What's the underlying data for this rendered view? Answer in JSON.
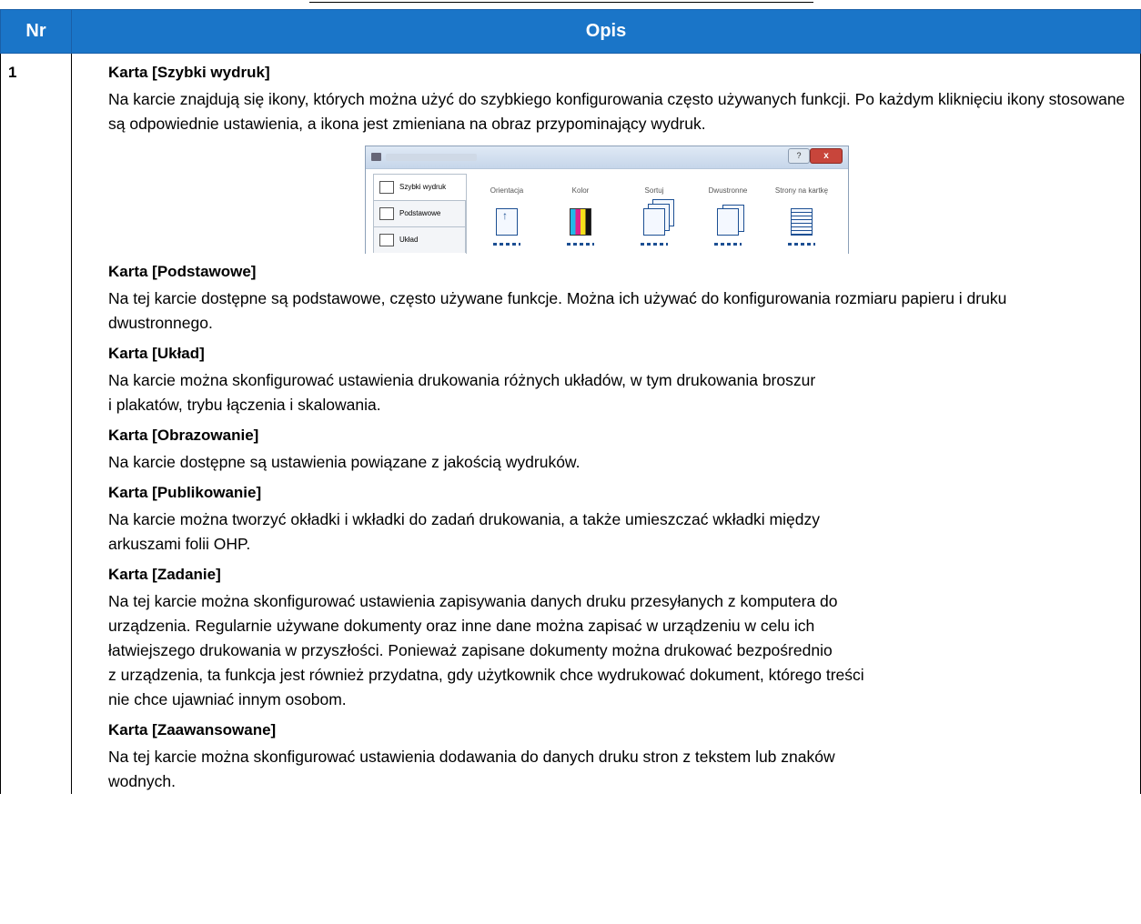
{
  "table": {
    "header_nr": "Nr",
    "header_opis": "Opis",
    "row_nr": "1"
  },
  "items": [
    {
      "title": "Karta [Szybki wydruk]",
      "text": "Na karcie znajdują się ikony, których można użyć do szybkiego konfigurowania często używanych funkcji. Po każdym kliknięciu ikony stosowane są odpowiednie ustawienia, a ikona jest zmieniana na obraz przypominający wydruk."
    },
    {
      "title": "Karta [Podstawowe]",
      "text": "Na tej karcie dostępne są podstawowe, często używane funkcje. Można ich używać do konfigurowania rozmiaru papieru i druku dwustronnego."
    },
    {
      "title": "Karta [Układ]",
      "text_line1": "Na karcie można skonfigurować ustawienia drukowania różnych układów, w tym drukowania broszur",
      "text_line2": "i plakatów, trybu łączenia i skalowania."
    },
    {
      "title": "Karta [Obrazowanie]",
      "text": "Na karcie dostępne są ustawienia powiązane z jakością wydruków."
    },
    {
      "title": "Karta [Publikowanie]",
      "text_line1": "Na karcie można tworzyć okładki i wkładki do zadań drukowania, a także umieszczać wkładki między",
      "text_line2": "arkuszami folii OHP."
    },
    {
      "title": "Karta [Zadanie]",
      "text_line1": "Na tej karcie można skonfigurować ustawienia zapisywania danych druku przesyłanych z komputera do",
      "text_line2": "urządzenia. Regularnie używane dokumenty oraz inne dane można zapisać w urządzeniu w celu ich",
      "text_line3": "łatwiejszego drukowania w przyszłości. Ponieważ zapisane dokumenty można drukować bezpośrednio",
      "text_line4": "z urządzenia, ta funkcja jest również przydatna, gdy użytkownik chce wydrukować dokument, którego treści",
      "text_line5": "nie chce ujawniać innym osobom."
    },
    {
      "title": "Karta [Zaawansowane]",
      "text_line1": "Na tej karcie można skonfigurować ustawienia dodawania do danych druku stron z tekstem lub znaków",
      "text_line2": "wodnych."
    }
  ],
  "dialog": {
    "help_label": "?",
    "close_label": "x",
    "side_tabs": [
      "Szybki wydruk",
      "Podstawowe",
      "Układ"
    ],
    "columns": [
      "Orientacja",
      "Kolor",
      "Sortuj",
      "Dwustronne",
      "Strony na kartkę"
    ],
    "icons": [
      "page-orientation-icon",
      "color-cmyk-icon",
      "collate-icon",
      "duplex-icon",
      "pages-per-sheet-icon"
    ]
  }
}
